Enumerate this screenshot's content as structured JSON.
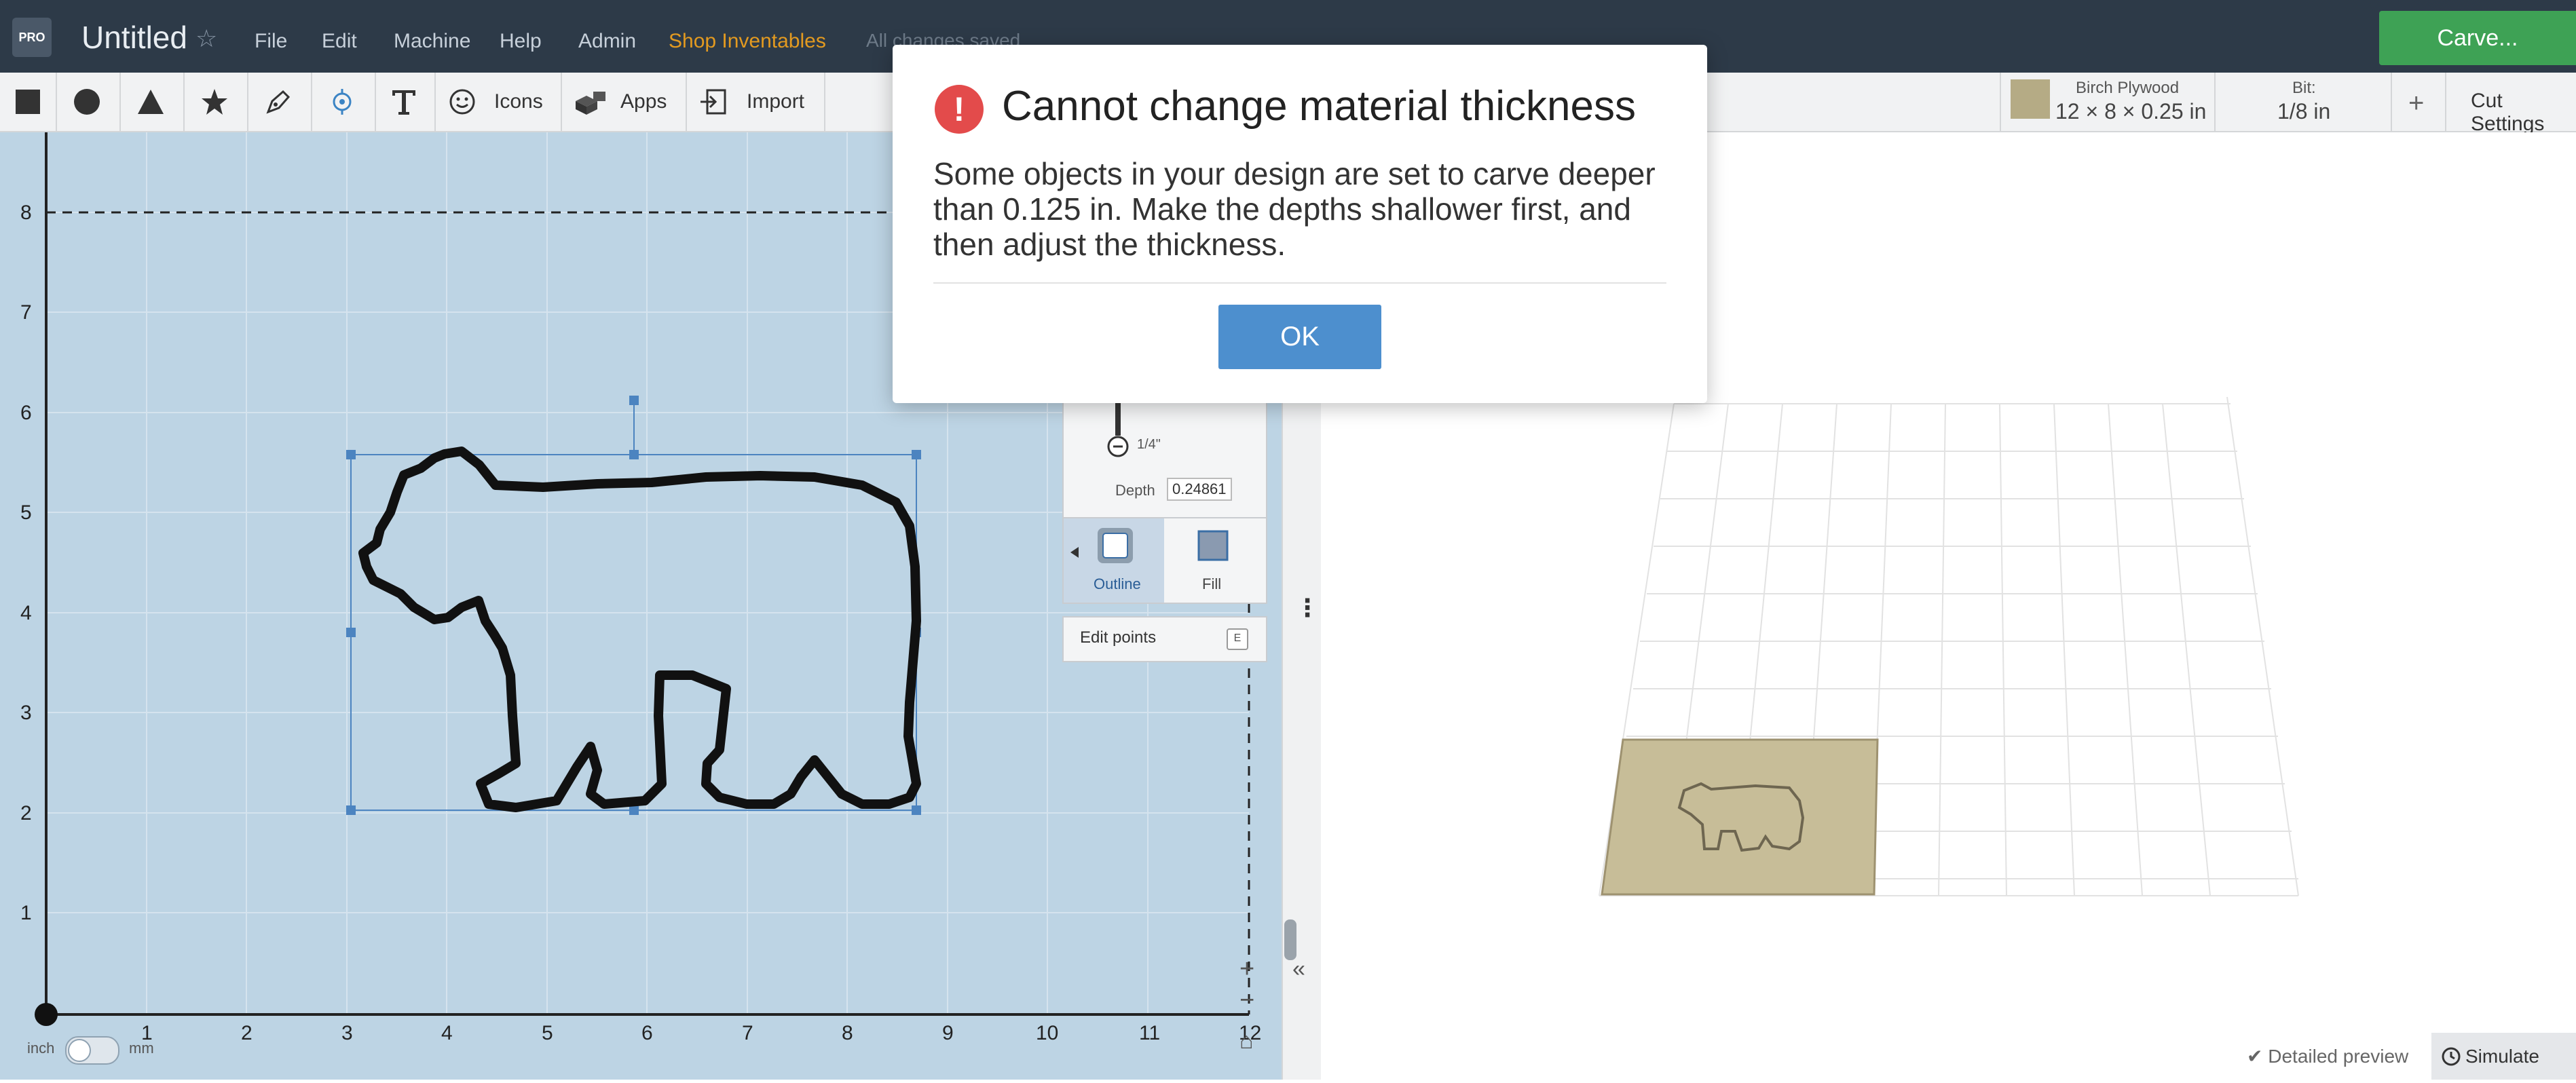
{
  "app": {
    "logo_text": "PRO",
    "title": "Untitled",
    "star_glyph": "☆",
    "menu": [
      "File",
      "Edit",
      "Machine",
      "Help",
      "Admin",
      "Shop Inventables"
    ],
    "save_status": "All changes saved",
    "carve_label": "Carve..."
  },
  "toolbar": {
    "icons_label": "Icons",
    "apps_label": "Apps",
    "import_label": "Import",
    "material_name": "Birch Plywood",
    "material_dims": "12 × 8 × 0.25 in",
    "bit_label": "Bit:",
    "bit_value": "1/8 in",
    "plus": "+",
    "cut_settings": "Cut Settings"
  },
  "canvas": {
    "y_ticks": [
      "8",
      "7",
      "6",
      "5",
      "4",
      "3",
      "2",
      "1"
    ],
    "x_ticks": [
      "1",
      "2",
      "3",
      "4",
      "5",
      "6",
      "7",
      "8",
      "9",
      "10",
      "11",
      "12"
    ],
    "unit_inch": "inch",
    "unit_mm": "mm",
    "zoom_in": "+",
    "zoom_out": "−",
    "home_glyph": "⌂"
  },
  "inspector": {
    "depth_scale_label": "1/4\"",
    "depth_label": "Depth",
    "depth_value": "0.24861",
    "outline_label": "Outline",
    "fill_label": "Fill",
    "edit_points_label": "Edit points",
    "edit_points_key": "E"
  },
  "divider": {
    "collapse_glyph": "«",
    "dots_glyph": "⋮"
  },
  "preview": {
    "detailed_preview": "Detailed preview",
    "simulate": "Simulate"
  },
  "modal": {
    "icon_glyph": "!",
    "title": "Cannot change material thickness",
    "body": "Some objects in your design are set to carve deeper than 0.125 in. Make the depths shallower first, and then adjust the thickness.",
    "ok_label": "OK"
  },
  "colors": {
    "topbar": "#2d3a48",
    "carve": "#3ea255",
    "canvas": "#bdd4e4",
    "modal_ok": "#4d8fce",
    "alert": "#e34b4b"
  }
}
